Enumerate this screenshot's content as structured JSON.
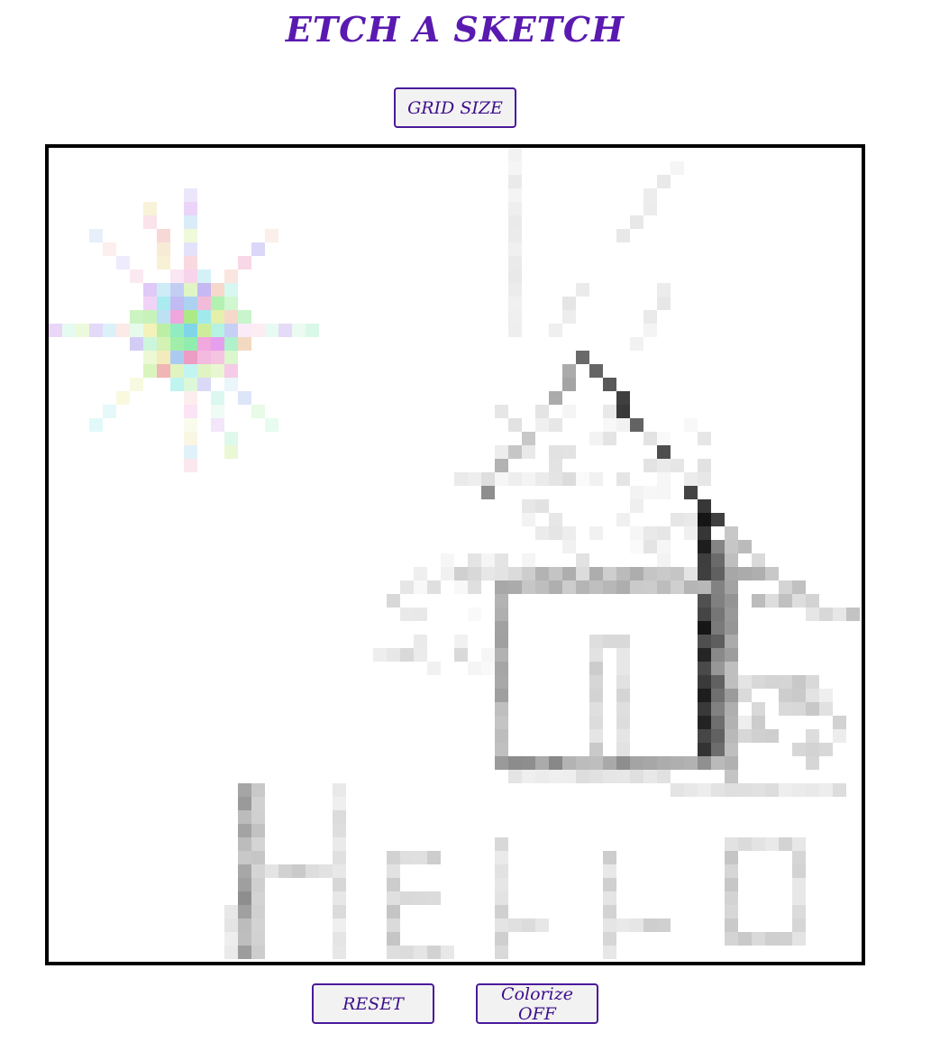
{
  "app": {
    "title": "ETCH A SKETCH"
  },
  "controls": {
    "grid_size_label": "GRID SIZE",
    "reset_label": "RESET",
    "colorize_label": "Colorize OFF"
  },
  "canvas": {
    "grid_size": 60,
    "background_color": "#ffffff",
    "border_color": "#000000"
  },
  "theme": {
    "accent": "#5a1ab0",
    "button_text": "#3d0f8a",
    "button_background": "#f2f2f2"
  }
}
